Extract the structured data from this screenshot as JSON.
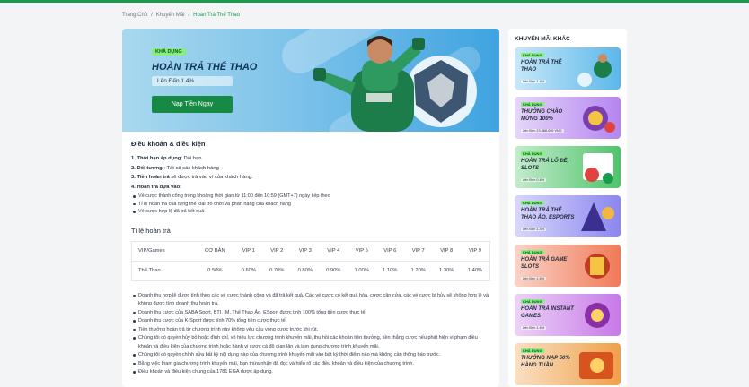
{
  "breadcrumb": [
    "Trang Chủ",
    "/",
    "Khuyến Mãi",
    "/",
    "Hoàn Trả Thể Thao"
  ],
  "hero": {
    "tag": "KHẢ DỤNG",
    "title": "HOÀN TRẢ THỂ THAO",
    "subtitle": "Lên Đến 1.4%",
    "cta": "Nạp Tiền Ngay"
  },
  "terms": {
    "heading": "Điều khoản & điều kiện",
    "items": [
      {
        "label": "1. Thời hạn áp dụng",
        "text": ": Dài hạn"
      },
      {
        "label": "2. Đối tượng",
        "text": " : Tất cả các khách hàng"
      },
      {
        "label": "3. Tiền hoàn trả",
        "text": " sẽ được trả vào ví của khách hàng."
      },
      {
        "label": "4. Hoàn trả dựa vào",
        "text": ":"
      }
    ],
    "bullets": [
      "Vé cược thành công trong khoảng thời gian từ 11:00 đến 10:59 (GMT+7) ngày tiếp theo",
      "Tỉ lệ hoàn trả của từng thể loại trò chơi và phân hạng của khách hàng",
      "Vé cược hợp lệ đã trả kết quả"
    ]
  },
  "table": {
    "title": "Tỉ lệ hoàn trả",
    "headers": [
      "VIP/Games",
      "CƠ BẢN",
      "VIP 1",
      "VIP 2",
      "VIP 3",
      "VIP 4",
      "VIP 5",
      "VIP 6",
      "VIP 7",
      "VIP 8",
      "VIP 9"
    ],
    "rows": [
      [
        "Thể Thao",
        "0.50%",
        "0.60%",
        "0.70%",
        "0.80%",
        "0.90%",
        "1.00%",
        "1.10%",
        "1.20%",
        "1.30%",
        "1.40%"
      ]
    ]
  },
  "notes": [
    "Doanh thu hợp lệ được tính theo các vé cược thành công và đã trả kết quả. Các vé cược có kết quả hòa, cược cân cửa, các vé cược bị hủy sẽ không hợp lệ và không được tính doanh thu hoàn trả.",
    "Doanh thu cược của SABA Sport, BTI, IM, Thể Thao Ảo, ESport được tính 100% tổng tiền cược thực tế.",
    "Doanh thu cược của K-Sport được tính 70% tổng tiền cược thực tế.",
    "Tiền thưởng hoàn trả từ chương trình này không yêu cầu vòng cược trước khi rút.",
    "Chúng tôi có quyền hủy bỏ hoặc đình chỉ, vô hiệu lực chương trình khuyến mãi, thu hồi các khoản tiền thưởng, tiền thắng cược nếu phát hiện vi phạm điều khoản và điều kiện của chương trình hoặc hành vi cược cá độ gian lận và lạm dụng chương trình khuyến mãi.",
    "Chúng tôi có quyền chỉnh sửa bất kỳ nội dung nào của chương trình khuyến mãi vào bất kỳ thời điểm nào mà không cần thông báo trước.",
    "Bằng việc tham gia chương trình khuyến mãi, bạn thừa nhận đã đọc và hiểu rõ các điều khoản và điều kiện của chương trình.",
    "Điều khoản và điều kiện chung của 1781 EGA được áp dụng."
  ],
  "sidebar": {
    "title": "KHUYẾN MÃI KHÁC",
    "cards": [
      {
        "tag": "KHẢ DỤNG",
        "name": "HOÀN TRẢ THỂ THAO",
        "sub": "Lên Đến 1.4%",
        "color": "#5bb8ea"
      },
      {
        "tag": "KHẢ DỤNG",
        "name": "THƯỞNG CHÀO MỪNG 100%",
        "sub": "Lên Đến 23,888,000 VND",
        "color": "#b585f0"
      },
      {
        "tag": "KHẢ DỤNG",
        "name": "HOÀN TRẢ LÔ ĐỀ, SLOTS",
        "sub": "Lên Đến 0.8%",
        "color": "#4fc46a"
      },
      {
        "tag": "KHẢ DỤNG",
        "name": "HOÀN TRẢ THỂ THAO ẢO, ESPORTS",
        "sub": "Lên Đến 1.4%",
        "color": "#8b87ef"
      },
      {
        "tag": "KHẢ DỤNG",
        "name": "HOÀN TRẢ GAME SLOTS",
        "sub": "Lên Đến 1.6%",
        "color": "#f07a58"
      },
      {
        "tag": "KHẢ DỤNG",
        "name": "HOÀN TRẢ INSTANT GAMES",
        "sub": "Lên Đến 1.6%",
        "color": "#c779e8"
      },
      {
        "tag": "KHẢ DỤNG",
        "name": "THƯỞNG NẠP 50% HÀNG TUẦN",
        "sub": "",
        "color": "#f0a04a"
      }
    ]
  }
}
